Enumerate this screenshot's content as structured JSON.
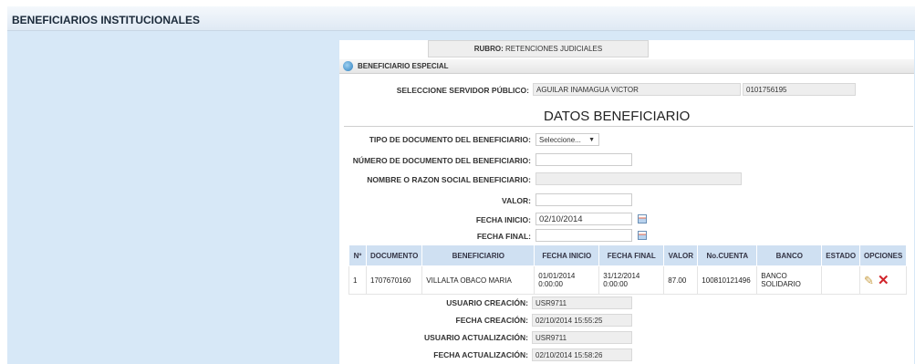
{
  "header": {
    "title": "BENEFICIARIOS INSTITUCIONALES"
  },
  "rubro": {
    "label": "RUBRO:",
    "value": "RETENCIONES JUDICIALES"
  },
  "section": {
    "title": "BENEFICIARIO ESPECIAL"
  },
  "servidor": {
    "label": "SELECCIONE SERVIDOR PÚBLICO:",
    "name": "AGUILAR INAMAGUA VICTOR",
    "id": "0101756195"
  },
  "form": {
    "heading": "DATOS BENEFICIARIO",
    "tipo_doc_label": "TIPO DE DOCUMENTO DEL BENEFICIARIO:",
    "tipo_doc_value": "Seleccione...",
    "num_doc_label": "NÚMERO DE DOCUMENTO DEL BENEFICIARIO:",
    "num_doc_value": "",
    "nombre_label": "NOMBRE O RAZON SOCIAL BENEFICIARIO:",
    "nombre_value": "",
    "valor_label": "VALOR:",
    "valor_value": "",
    "fecha_inicio_label": "FECHA INICIO:",
    "fecha_inicio_value": "02/10/2014",
    "fecha_final_label": "FECHA FINAL:",
    "fecha_final_value": ""
  },
  "table": {
    "columns": [
      "Nº",
      "DOCUMENTO",
      "BENEFICIARIO",
      "FECHA INICIO",
      "FECHA FINAL",
      "VALOR",
      "No.CUENTA",
      "BANCO",
      "ESTADO",
      "OPCIONES"
    ],
    "rows": [
      {
        "n": "1",
        "documento": "1707670160",
        "beneficiario": "VILLALTA OBACO MARIA",
        "fecha_inicio": "01/01/2014 0:00:00",
        "fecha_final": "31/12/2014 0:00:00",
        "valor": "87.00",
        "cuenta": "100810121496",
        "banco": "BANCO SOLIDARIO",
        "estado": ""
      }
    ]
  },
  "audit": {
    "usuario_creacion_label": "USUARIO CREACIÓN:",
    "usuario_creacion": "USR9711",
    "fecha_creacion_label": "FECHA CREACIÓN:",
    "fecha_creacion": "02/10/2014 15:55:25",
    "usuario_actualizacion_label": "USUARIO ACTUALIZACIÓN:",
    "usuario_actualizacion": "USR9711",
    "fecha_actualizacion_label": "FECHA ACTUALIZACIÓN:",
    "fecha_actualizacion": "02/10/2014 15:58:26"
  },
  "icons": {
    "section": "info-bullet-icon",
    "calendar": "calendar-icon",
    "edit": "pencil-icon",
    "delete": "delete-x-icon"
  }
}
